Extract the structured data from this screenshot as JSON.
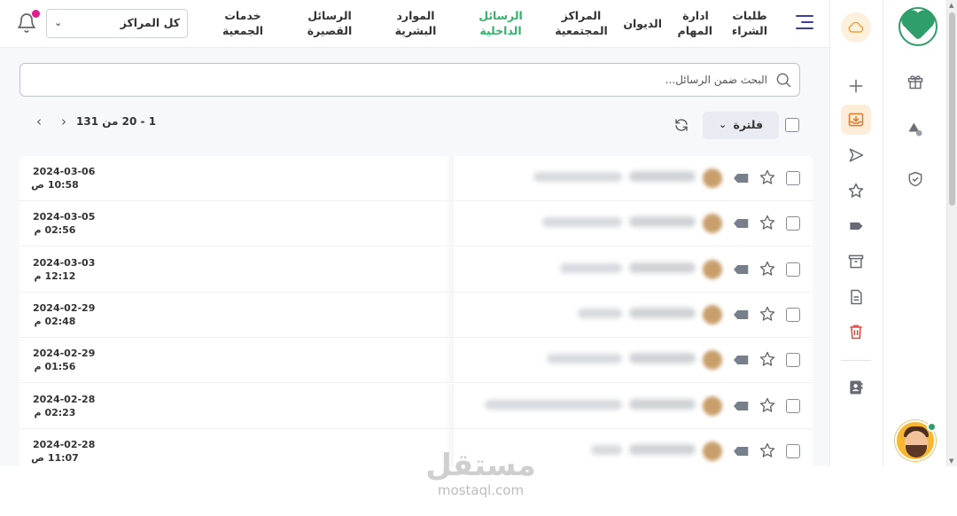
{
  "nav": {
    "items": [
      {
        "line1": "طلبات",
        "line2": "الشراء"
      },
      {
        "line1": "ادارة",
        "line2": "المهام"
      },
      {
        "line1": "الديوان",
        "line2": ""
      },
      {
        "line1": "المراكز",
        "line2": "المجتمعية"
      },
      {
        "line1": "الرسائل",
        "line2": "الداخلية"
      },
      {
        "line1": "الموارد",
        "line2": "البشرية"
      },
      {
        "line1": "الرسائل",
        "line2": "القصيرة"
      },
      {
        "line1": "خدمات",
        "line2": "الجمعية"
      }
    ],
    "center_select": "كل المراكز",
    "colors": {
      "active": "#34b26b",
      "accent": "#3a3f9e",
      "notification": "#e11d8f"
    }
  },
  "search": {
    "placeholder": "البحث ضمن الرسائل..."
  },
  "toolbar": {
    "pager": "1 - 20 من 131",
    "filter_label": "فلترة"
  },
  "messages": [
    {
      "date": "2024-03-06",
      "time": "10:58 ص"
    },
    {
      "date": "2024-03-05",
      "time": "02:56 م"
    },
    {
      "date": "2024-03-03",
      "time": "12:12 م"
    },
    {
      "date": "2024-02-29",
      "time": "02:48 م"
    },
    {
      "date": "2024-02-29",
      "time": "01:56 م"
    },
    {
      "date": "2024-02-28",
      "time": "02:23 م"
    },
    {
      "date": "2024-02-28",
      "time": "11:07 ص"
    }
  ],
  "watermark": {
    "arabic": "مستقل",
    "latin": "mostaql.com"
  }
}
